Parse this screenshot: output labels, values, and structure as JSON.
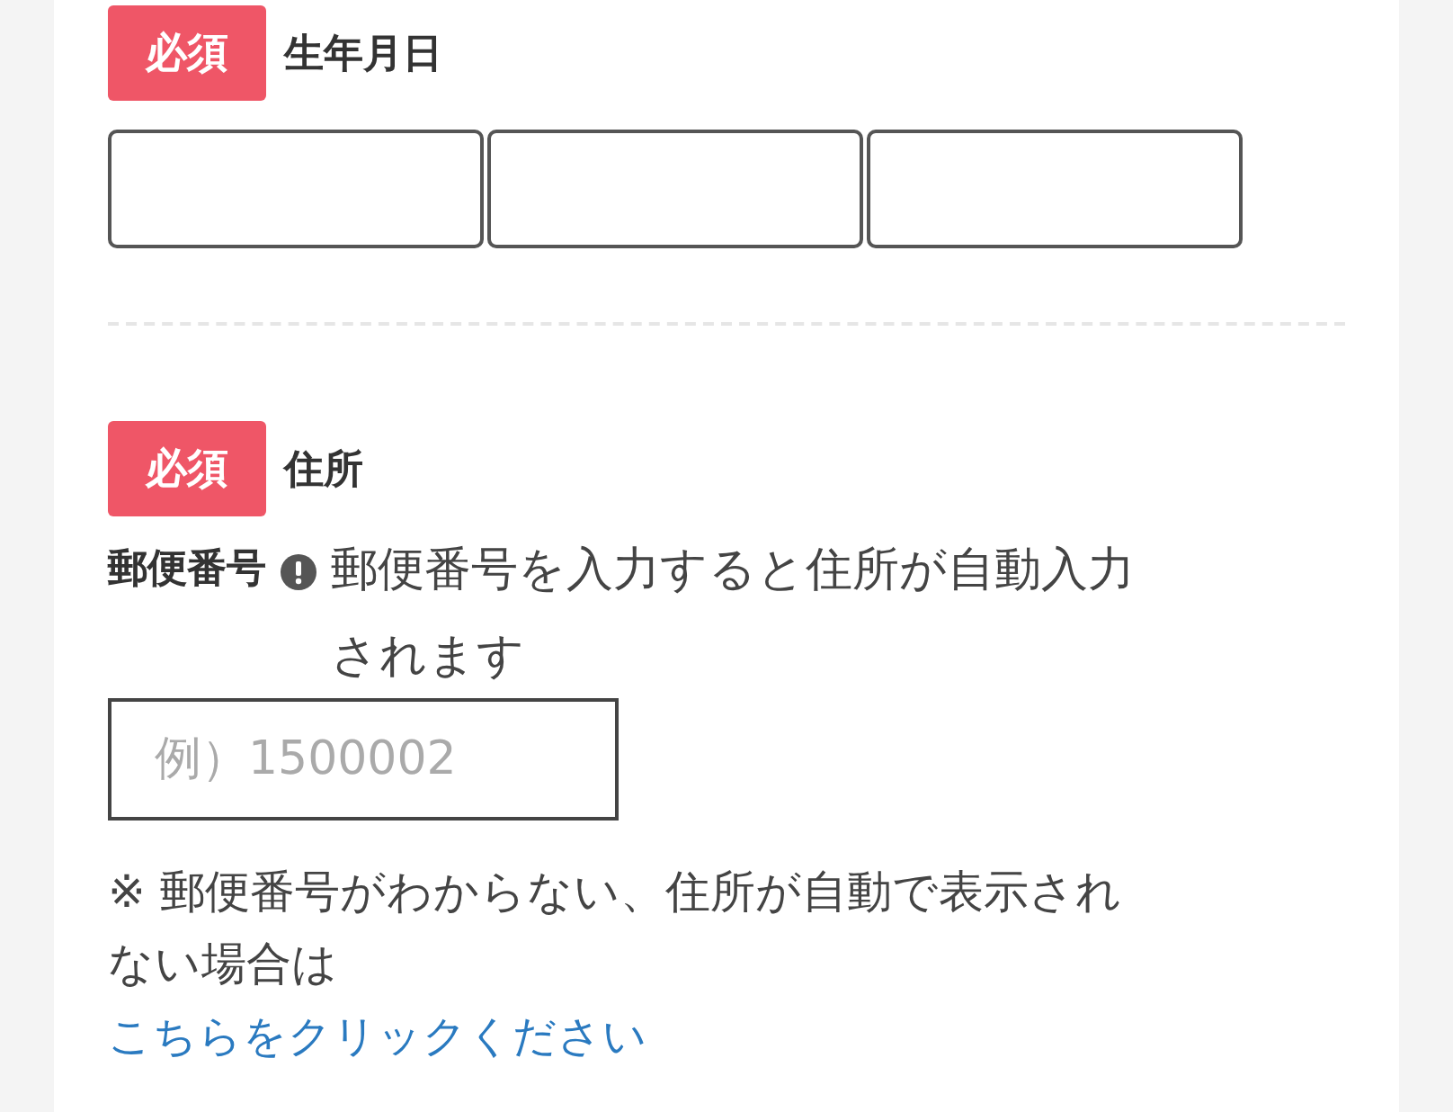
{
  "sections": [
    {
      "badge": "必須",
      "label": "生年月日",
      "fields": [
        {
          "kind": "text"
        },
        {
          "kind": "text"
        },
        {
          "kind": "text"
        }
      ]
    },
    {
      "badge": "必須",
      "label": "住所",
      "postal": {
        "label": "郵便番号",
        "hint": "郵便番号を入力すると住所が自動入力されます",
        "placeholder": "例）1500002"
      },
      "note": "※ 郵便番号がわからない、住所が自動で表示されない場合は",
      "link": "こちらをクリックください"
    }
  ]
}
